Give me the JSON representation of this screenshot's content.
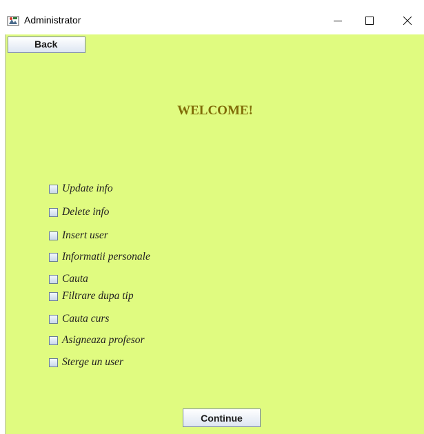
{
  "window": {
    "title": "Administrator",
    "controls": [
      "minimize",
      "maximize",
      "close"
    ]
  },
  "toolbar": {
    "back_label": "Back"
  },
  "main": {
    "heading": "WELCOME!",
    "heading_color": "#806c08",
    "background_color": "#e0fb80",
    "options": [
      {
        "label": "Update info",
        "checked": false
      },
      {
        "label": "Delete info",
        "checked": false
      },
      {
        "label": "Insert user",
        "checked": false
      },
      {
        "label": "Informatii personale",
        "checked": false
      },
      {
        "label": "Cauta",
        "checked": false
      },
      {
        "label": "Filtrare dupa tip",
        "checked": false
      },
      {
        "label": "Cauta curs",
        "checked": false
      },
      {
        "label": "Asigneaza profesor",
        "checked": false
      },
      {
        "label": "Sterge un user",
        "checked": false
      }
    ],
    "continue_label": "Continue"
  },
  "icons": {
    "app": "java-app-icon",
    "minimize": "minimize-icon",
    "maximize": "maximize-icon",
    "close": "close-icon"
  }
}
